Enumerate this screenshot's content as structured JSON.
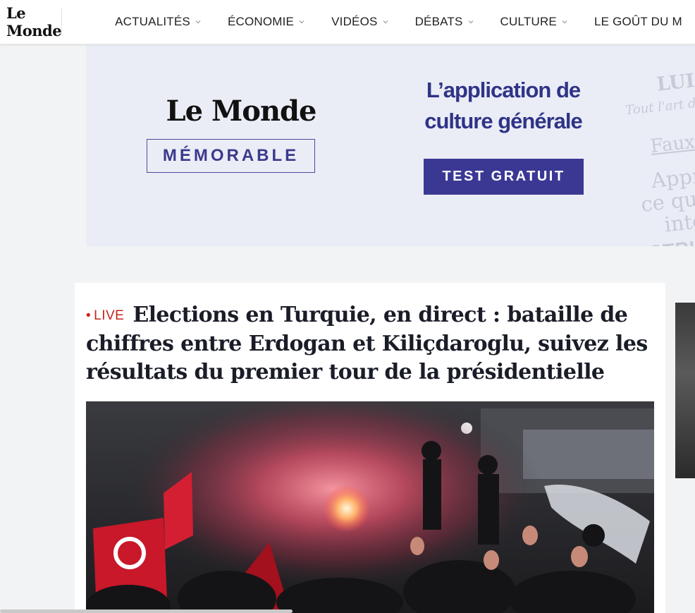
{
  "header": {
    "logo": "Le Monde",
    "nav": [
      {
        "label": "ACTUALITÉS"
      },
      {
        "label": "ÉCONOMIE"
      },
      {
        "label": "VIDÉOS"
      },
      {
        "label": "DÉBATS"
      },
      {
        "label": "CULTURE"
      },
      {
        "label": "LE GOÛT DU M"
      }
    ]
  },
  "ad": {
    "logo": "Le Monde",
    "product": "MÉMORABLE",
    "tagline_line1": "L’application de",
    "tagline_line2": "culture générale",
    "cta": "TEST GRATUIT",
    "side_text": [
      "LUI",
      "Tout l'art d",
      "Faux",
      "Appr",
      "ce qui",
      "intér",
      "INSTRU"
    ]
  },
  "article": {
    "live_label": "LIVE",
    "headline": "Elections en Turquie, en direct : bataille de chiffres entre Erdogan et Kiliçdaroglu, suivez les résultats du premier tour de la présidentielle"
  },
  "colors": {
    "live_red": "#c6241c",
    "ad_purple": "#3b3894",
    "ad_bg": "#ebedf6"
  }
}
